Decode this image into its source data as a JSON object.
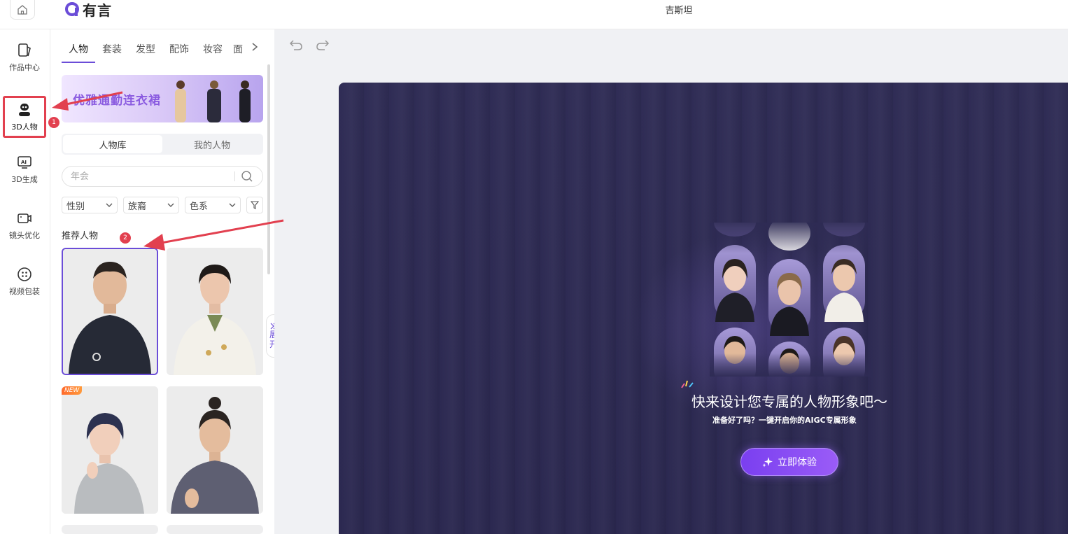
{
  "app": {
    "logo_text": "有言",
    "doc_title": "吉斯坦"
  },
  "leftnav": {
    "items": [
      {
        "label": "作品中心",
        "icon": "works-icon"
      },
      {
        "label": "3D人物",
        "icon": "robot-icon"
      },
      {
        "label": "3D生成",
        "icon": "ai-monitor-icon"
      },
      {
        "label": "镜头优化",
        "icon": "camera-icon"
      },
      {
        "label": "视频包装",
        "icon": "package-icon"
      }
    ],
    "active_index": 1
  },
  "annotations": {
    "marker_1": "1",
    "marker_2": "2"
  },
  "panel": {
    "tabs": [
      "人物",
      "套装",
      "发型",
      "配饰",
      "妆容",
      "面"
    ],
    "active_tab": "人物",
    "banner_text": "优雅通勤连衣裙",
    "segments": [
      "人物库",
      "我的人物"
    ],
    "active_segment": "人物库",
    "search_placeholder": "年会",
    "filters": [
      "性别",
      "族裔",
      "色系"
    ],
    "section_title": "推荐人物",
    "new_tag": "NEW",
    "expand_label_1": "展",
    "expand_label_2": "开"
  },
  "stage": {
    "promo_title": "快来设计您专属的人物形象吧～",
    "promo_subtitle": "准备好了吗？一键开启你的AIGC专属形象",
    "cta_label": "立即体验"
  },
  "colors": {
    "accent": "#6b4dd8",
    "annotation_red": "#e2404f",
    "stage_bg": "#2f2c55"
  }
}
